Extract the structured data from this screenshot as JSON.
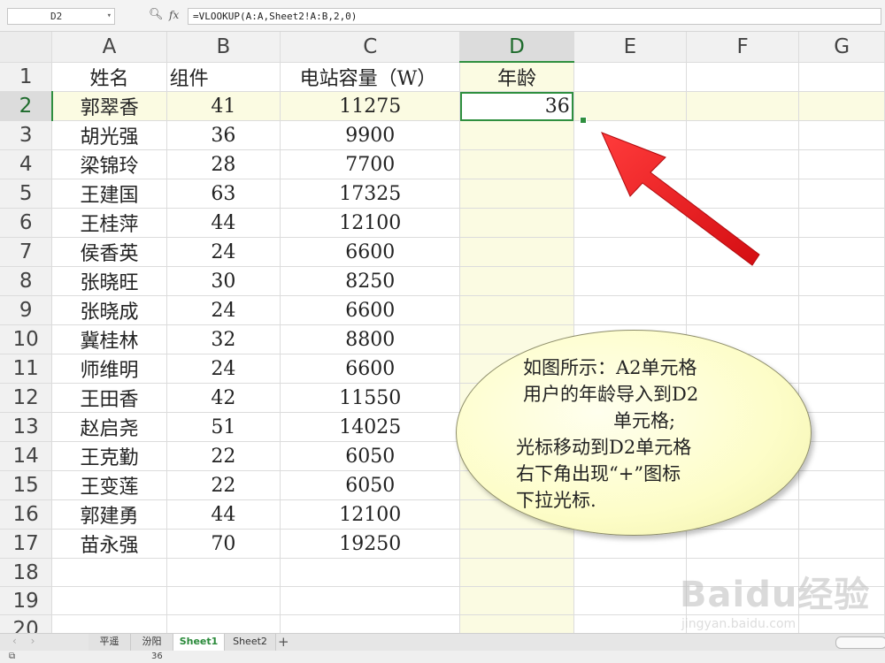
{
  "formula_bar": {
    "name_box": "D2",
    "fx_label": "fx",
    "formula": "=VLOOKUP(A:A,Sheet2!A:B,2,0)"
  },
  "columns": [
    "A",
    "B",
    "C",
    "D",
    "E",
    "F",
    "G"
  ],
  "header_row": {
    "a": "姓名",
    "b": "组件",
    "c": "电站容量（W）",
    "d": "年龄"
  },
  "rows": [
    {
      "n": "2",
      "a": "郭翠香",
      "b": "41",
      "c": "11275",
      "d": "36"
    },
    {
      "n": "3",
      "a": "胡光强",
      "b": "36",
      "c": "9900",
      "d": ""
    },
    {
      "n": "4",
      "a": "梁锦玲",
      "b": "28",
      "c": "7700",
      "d": ""
    },
    {
      "n": "5",
      "a": "王建国",
      "b": "63",
      "c": "17325",
      "d": ""
    },
    {
      "n": "6",
      "a": "王桂萍",
      "b": "44",
      "c": "12100",
      "d": ""
    },
    {
      "n": "7",
      "a": "侯香英",
      "b": "24",
      "c": "6600",
      "d": ""
    },
    {
      "n": "8",
      "a": "张晓旺",
      "b": "30",
      "c": "8250",
      "d": ""
    },
    {
      "n": "9",
      "a": "张晓成",
      "b": "24",
      "c": "6600",
      "d": ""
    },
    {
      "n": "10",
      "a": "冀桂林",
      "b": "32",
      "c": "8800",
      "d": ""
    },
    {
      "n": "11",
      "a": "师维明",
      "b": "24",
      "c": "6600",
      "d": ""
    },
    {
      "n": "12",
      "a": "王田香",
      "b": "42",
      "c": "11550",
      "d": ""
    },
    {
      "n": "13",
      "a": "赵启尧",
      "b": "51",
      "c": "14025",
      "d": ""
    },
    {
      "n": "14",
      "a": "王克勤",
      "b": "22",
      "c": "6050",
      "d": ""
    },
    {
      "n": "15",
      "a": "王变莲",
      "b": "22",
      "c": "6050",
      "d": ""
    },
    {
      "n": "16",
      "a": "郭建勇",
      "b": "44",
      "c": "12100",
      "d": ""
    },
    {
      "n": "17",
      "a": "苗永强",
      "b": "70",
      "c": "19250",
      "d": ""
    },
    {
      "n": "18",
      "a": "",
      "b": "",
      "c": "",
      "d": ""
    },
    {
      "n": "19",
      "a": "",
      "b": "",
      "c": "",
      "d": ""
    },
    {
      "n": "20",
      "a": "",
      "b": "",
      "c": "",
      "d": ""
    }
  ],
  "annotation": {
    "lines": [
      "如图所示：A2单元格",
      "用户的年龄导入到D2",
      "单元格;",
      "光标移动到D2单元格",
      "右下角出现“+”图标",
      "下拉光标."
    ],
    "arrow_color": "#e8151b"
  },
  "sheet_tabs": [
    {
      "label": "平遥",
      "active": false
    },
    {
      "label": "汾阳",
      "active": false
    },
    {
      "label": "Sheet1",
      "active": true
    },
    {
      "label": "Sheet2",
      "active": false
    }
  ],
  "add_sheet_label": "+",
  "status_bar": {
    "value": "36"
  },
  "watermark": {
    "logo": "Baidu经验",
    "url": "jingyan.baidu.com"
  },
  "colors": {
    "selection_green": "#2f8f3f",
    "highlight_yellow": "#fbfbe2",
    "active_tab_text": "#2a8a3a"
  }
}
